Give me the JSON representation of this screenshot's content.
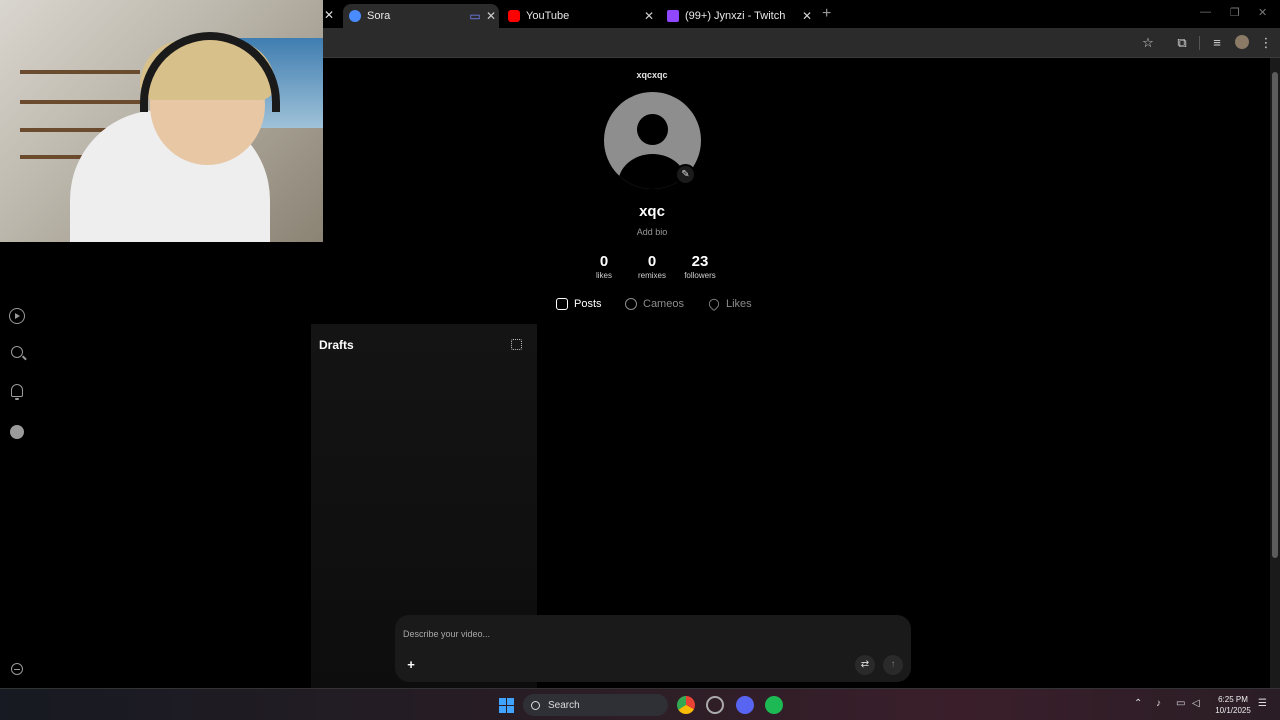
{
  "browser": {
    "tabs": [
      {
        "title": "Sora",
        "active": true,
        "favicon_color": "#4a8cff"
      },
      {
        "title": "YouTube",
        "active": false,
        "favicon_color": "#ff0000"
      },
      {
        "title": "(99+) Jynxzi - Twitch",
        "active": false,
        "favicon_color": "#9146ff"
      }
    ],
    "new_tab_glyph": "+"
  },
  "sidebar": {
    "items": [
      "home-feed",
      "search",
      "notifications",
      "profile",
      "settings"
    ]
  },
  "profile": {
    "username": "xqcxqc",
    "display_name": "xqc",
    "bio_placeholder": "Add bio",
    "stats": [
      {
        "value": "0",
        "label": "likes"
      },
      {
        "value": "0",
        "label": "remixes"
      },
      {
        "value": "23",
        "label": "followers"
      }
    ],
    "tabs": [
      {
        "label": "Posts",
        "active": true
      },
      {
        "label": "Cameos",
        "active": false
      },
      {
        "label": "Likes",
        "active": false
      }
    ]
  },
  "drafts": {
    "title": "Drafts"
  },
  "prompt": {
    "placeholder": "Describe your video..."
  },
  "taskbar": {
    "search_label": "Search",
    "time": "6:25 PM",
    "date": "10/1/2025"
  }
}
